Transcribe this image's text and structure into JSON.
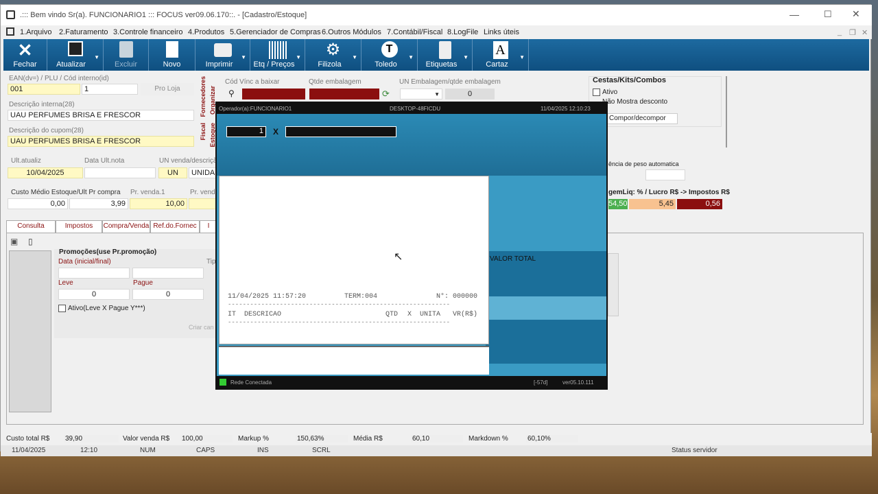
{
  "window": {
    "title": ".::: Bem vindo Sr(a). FUNCIONARIO1 ::: FOCUS ver09.06.170::.  - [Cadastro/Estoque]"
  },
  "menu": [
    "1.Arquivo",
    "2.Faturamento",
    "3.Controle financeiro",
    "4.Produtos",
    "5.Gerenciador de Compras",
    "6.Outros Módulos",
    "7.Contábil/Fiscal",
    "8.LogFile",
    "Links úteis"
  ],
  "toolbar": [
    "Fechar",
    "Atualizar",
    "Excluir",
    "Novo",
    "Imprimir",
    "Etq / Preços",
    "Filizola",
    "Toledo",
    "Etiquetas",
    "Cartaz"
  ],
  "form": {
    "ean_label": "EAN(dv=) / PLU / Cód interno(id)",
    "ean": "001",
    "plu": "1",
    "pro_loja": "Pro Loja",
    "desc_int_label": "Descrição interna(28)",
    "desc_int": "UAU PERFUMES BRISA E FRESCOR",
    "desc_cup_label": "Descrição do cupom(28)",
    "desc_cup": "UAU PERFUMES BRISA E FRESCOR",
    "ult_at_label": "Ult.atualiz",
    "ult_at": "10/04/2025",
    "ult_nota_label": "Data Ult.nota",
    "un_label": "UN venda/descriçã",
    "un": "UN",
    "un_desc": "UNIDAD",
    "custo_label": "Custo Médio Estoque/Ult Pr compra",
    "custo_medio": "0,00",
    "ult_pr": "3,99",
    "pv1_label": "Pr. venda.1",
    "pv1": "10,00",
    "pv2_label": "Pr. venda",
    "cod_vinc_label": "Cód Vínc a baixar",
    "qtde_label": "Qtde embalagem",
    "un_emb_label": "UN Embalagem/qtde embalagem",
    "un_emb_qtd": "0"
  },
  "vtabs": [
    "Fornecedores",
    "Organizar",
    "Fiscal",
    "Estoque"
  ],
  "cestas": {
    "title": "Cestas/Kits/Combos",
    "ativo": "Ativo",
    "nao_mostra": "Não Mostra desconto",
    "compor": "Compor/decompor",
    "peso": "ência de peso automatica",
    "margem_label": "gemLiq: % / Lucro R$ -> Impostos R$",
    "m1": "54,50",
    "m2": "5,45",
    "m3": "0,56"
  },
  "tabs": [
    "Consulta",
    "Impostos",
    "Compra/Venda",
    "Ref.do.Fornec",
    "I"
  ],
  "promo": {
    "title": "Promoções(use Pr.promoção)",
    "data_label": "Data (inicial/final)",
    "tip": "Tip",
    "leve_label": "Leve",
    "pague_label": "Pague",
    "leve": "0",
    "pague": "0",
    "ativo": "Ativo(Leve X Pague Y***)",
    "criar": "Criar can"
  },
  "pos": {
    "operador": "Operador(a):FUNCIONARIO1",
    "desktop": "DESKTOP-48FICDU",
    "datetime": "11/04/2025 12:10:23",
    "qty": "1",
    "x": "X",
    "valor_total": "VALOR TOTAL",
    "receipt_date": "11/04/2025 11:57:20",
    "term": "TERM:004",
    "num": "N°: 000000",
    "hdr_it": "IT",
    "hdr_desc": "DESCRICAO",
    "hdr_qtd": "QTD",
    "hdr_x": "X",
    "hdr_unita": "UNITA",
    "hdr_vr": "VR(R$)",
    "dashes": "------------------------------------------------------------",
    "rede": "Rede Conectada",
    "d57": "[-57d]",
    "ver": "ver05.10.111"
  },
  "totals": {
    "custo_label": "Custo total R$",
    "custo": "39,90",
    "venda_label": "Valor venda R$",
    "venda": "100,00",
    "markup_label": "Markup %",
    "markup": "150,63%",
    "media_label": "Média R$",
    "media": "60,10",
    "markdown_label": "Markdown %",
    "markdown": "60,10%"
  },
  "statusbar": {
    "date": "11/04/2025",
    "time": "12:10",
    "num": "NUM",
    "caps": "CAPS",
    "ins": "INS",
    "scrl": "SCRL",
    "servidor": "Status servidor"
  }
}
